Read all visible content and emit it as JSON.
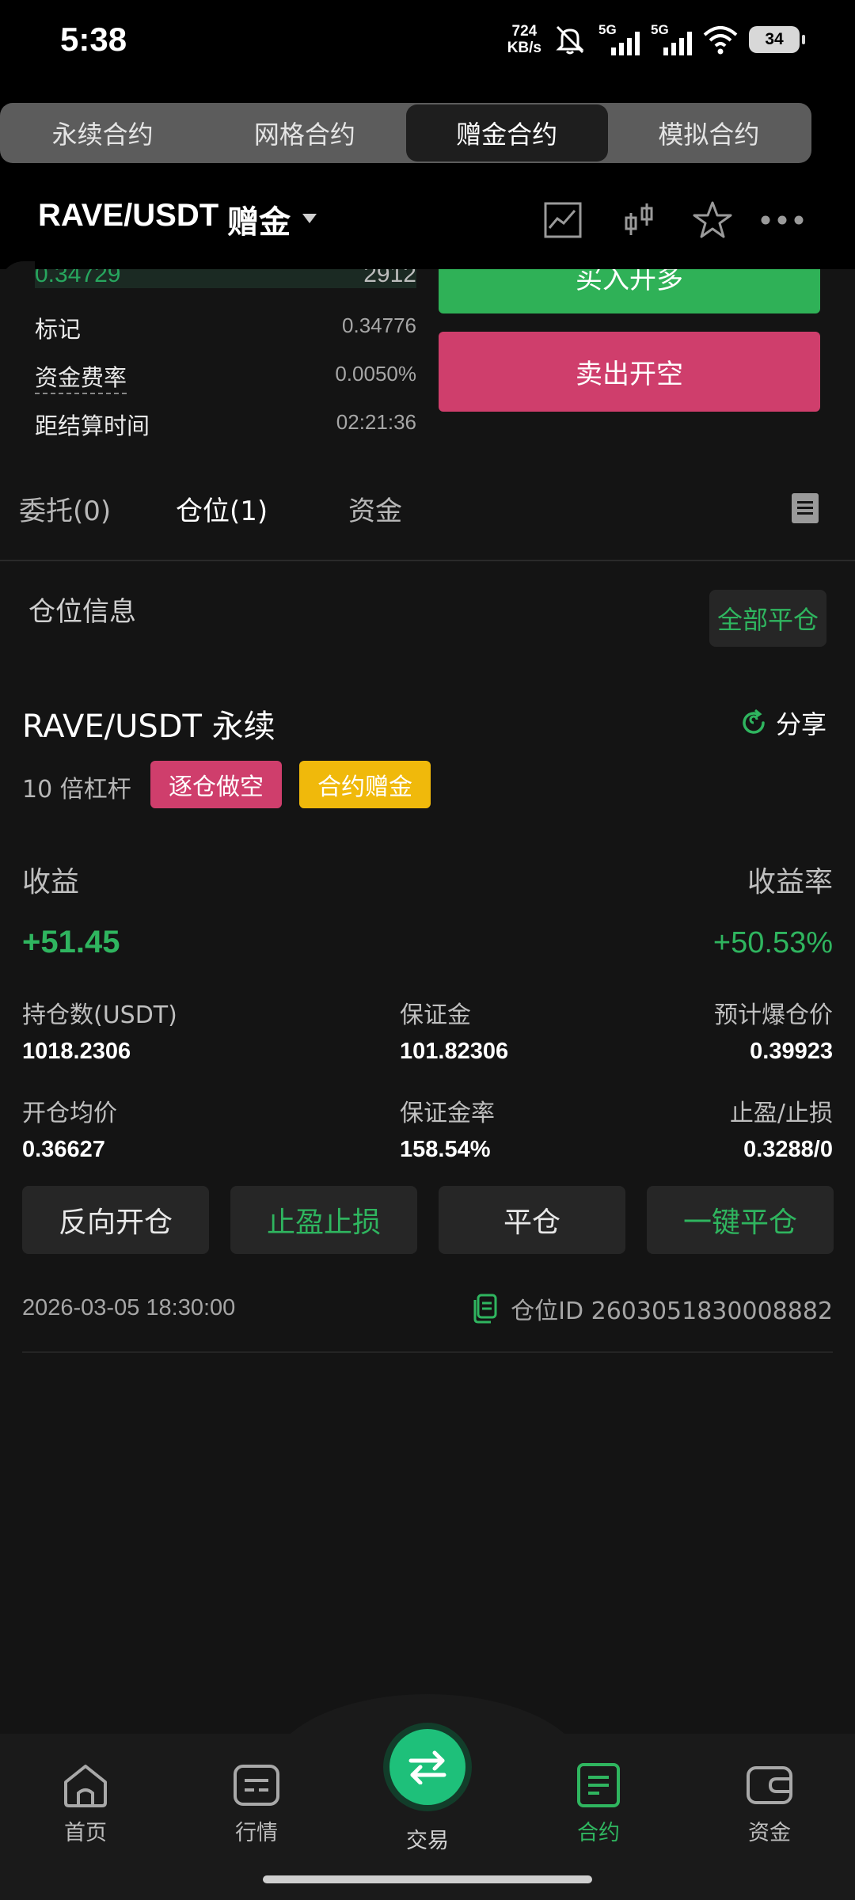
{
  "status_bar": {
    "time": "5:38",
    "net_speed_value": "724",
    "net_speed_unit": "KB/s",
    "signal_1": "5G",
    "signal_2": "5G",
    "battery": "34"
  },
  "segment_tabs": [
    {
      "label": "永续合约",
      "active": false
    },
    {
      "label": "网格合约",
      "active": false
    },
    {
      "label": "赠金合约",
      "active": true
    },
    {
      "label": "模拟合约",
      "active": false
    }
  ],
  "header": {
    "pair": "RAVE/USDT",
    "badge": "赠金",
    "icons": [
      "chart-line-icon",
      "candlestick-icon",
      "star-icon",
      "more-icon"
    ]
  },
  "order_book": {
    "price": "0.34729",
    "qty": "2912"
  },
  "market_info": {
    "mark_label": "标记",
    "mark_value": "0.34776",
    "funding_label": "资金费率",
    "funding_value": "0.0050%",
    "settle_label": "距结算时间",
    "settle_value": "02:21:36"
  },
  "trade_buttons": {
    "buy": "买入开多",
    "sell": "卖出开空"
  },
  "section_tabs": [
    {
      "label": "委托(0)",
      "active": false
    },
    {
      "label": "仓位(1)",
      "active": true
    },
    {
      "label": "资金",
      "active": false
    }
  ],
  "positions": {
    "title": "仓位信息",
    "close_all": "全部平仓",
    "item": {
      "pair": "RAVE/USDT 永续",
      "share": "分享",
      "leverage": "10 倍杠杆",
      "tag_side": "逐仓做空",
      "tag_bonus": "合约赠金",
      "profit_label": "收益",
      "profit_rate_label": "收益率",
      "profit": "+51.45",
      "profit_rate": "+50.53%",
      "size_label": "持仓数(USDT)",
      "size": "1018.2306",
      "margin_label": "保证金",
      "margin": "101.82306",
      "liq_label": "预计爆仓价",
      "liq": "0.39923",
      "entry_label": "开仓均价",
      "entry": "0.36627",
      "margin_rate_label": "保证金率",
      "margin_rate": "158.54%",
      "tpsl_label": "止盈/止损",
      "tpsl": "0.3288/0",
      "actions": [
        "反向开仓",
        "止盈止损",
        "平仓",
        "一键平仓"
      ],
      "date": "2026-03-05 18:30:00",
      "id_label": "仓位ID 2603051830008882"
    }
  },
  "bottom_nav": [
    {
      "label": "首页",
      "icon": "home-icon",
      "active": false
    },
    {
      "label": "行情",
      "icon": "market-icon",
      "active": false
    },
    {
      "label": "交易",
      "icon": "swap-icon",
      "active": false
    },
    {
      "label": "合约",
      "icon": "contract-icon",
      "active": true
    },
    {
      "label": "资金",
      "icon": "wallet-icon",
      "active": false
    }
  ],
  "colors": {
    "green": "#2fb55f",
    "red": "#cf3e6c",
    "yellow": "#f0b90b"
  }
}
